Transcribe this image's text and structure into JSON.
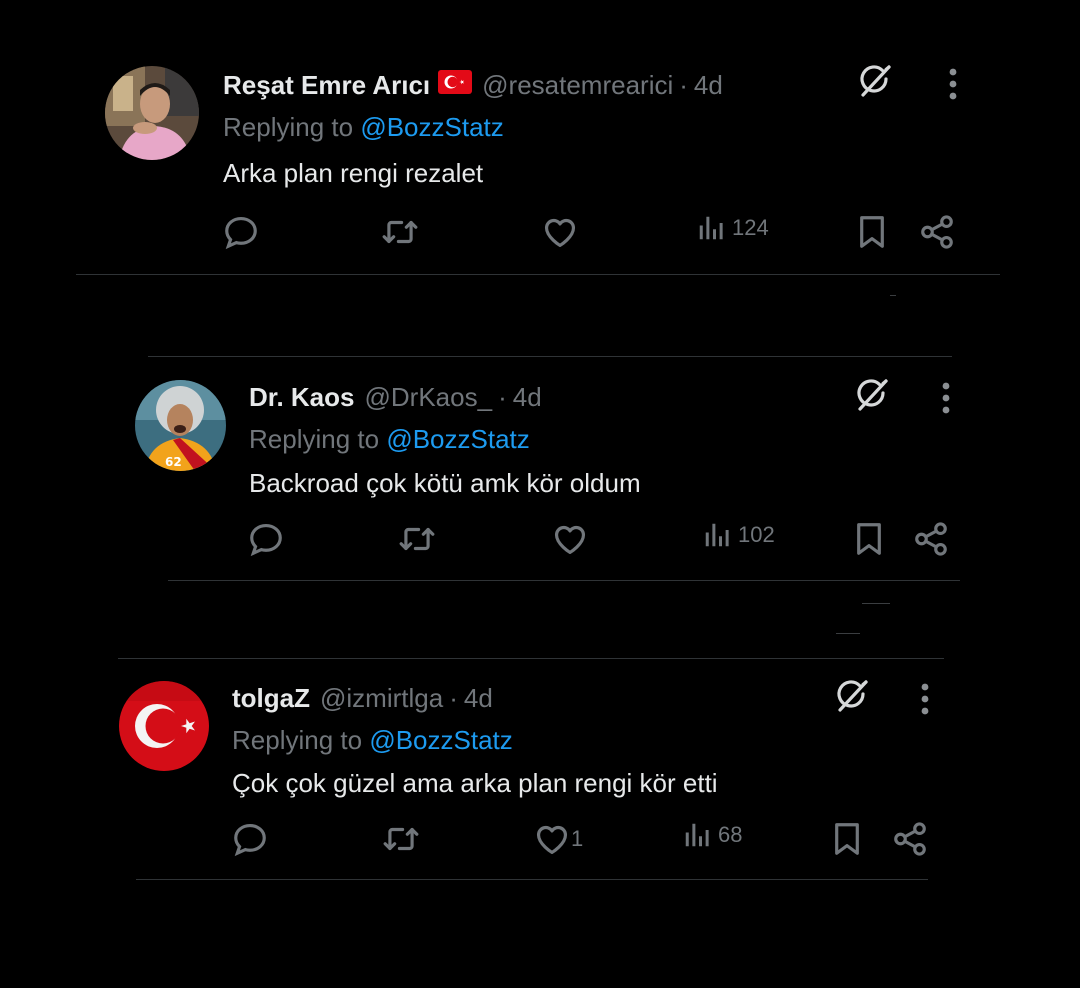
{
  "tweets": [
    {
      "name": "Reşat Emre Arıcı",
      "flag": "turkey-flag",
      "handle": "@resatemrearici",
      "separator": "·",
      "time": "4d",
      "replying_prefix": "Replying to",
      "replying_to": "@BozzStatz",
      "text": "Arka plan rengi rezalet",
      "likes": "",
      "views": "124"
    },
    {
      "name": "Dr. Kaos",
      "handle": "@DrKaos_",
      "separator": "·",
      "time": "4d",
      "replying_prefix": "Replying to",
      "replying_to": "@BozzStatz",
      "text": "Backroad çok kötü amk kör oldum",
      "likes": "",
      "views": "102"
    },
    {
      "name": "tolgaZ",
      "handle": "@izmirtlga",
      "separator": "·",
      "time": "4d",
      "replying_prefix": "Replying to",
      "replying_to": "@BozzStatz",
      "text": "Çok çok güzel ama arka plan rengi kör etti",
      "likes": "1",
      "views": "68"
    }
  ],
  "colors": {
    "background": "#000000",
    "text": "#e7e9ea",
    "muted": "#71767b",
    "mention": "#1d9bf0",
    "divider": "#2f3336",
    "flag_red": "#e30a17"
  },
  "icons": [
    "grok-icon",
    "more-icon",
    "reply-icon",
    "retweet-icon",
    "like-icon",
    "views-icon",
    "bookmark-icon",
    "share-icon"
  ]
}
